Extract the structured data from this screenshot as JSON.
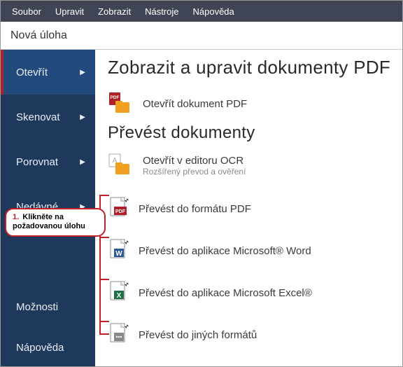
{
  "menubar": {
    "items": [
      "Soubor",
      "Upravit",
      "Zobrazit",
      "Nástroje",
      "Nápověda"
    ]
  },
  "title": "Nová úloha",
  "sidebar": {
    "nav": [
      {
        "label": "Otevřít",
        "hasArrow": true,
        "active": true
      },
      {
        "label": "Skenovat",
        "hasArrow": true
      },
      {
        "label": "Porovnat",
        "hasArrow": true
      },
      {
        "label": "Nedávné",
        "hasArrow": true
      }
    ],
    "bottom": [
      {
        "label": "Možnosti"
      },
      {
        "label": "Nápověda"
      }
    ]
  },
  "main": {
    "section1_title": "Zobrazit a upravit dokumenty PDF",
    "open_pdf_label": "Otevřít dokument PDF",
    "section2_title": "Převést dokumenty",
    "open_ocr_label": "Otevřít v editoru OCR",
    "open_ocr_sub": "Rozšířený převod a ověření",
    "convert": [
      {
        "label": "Převést do formátu PDF",
        "badge": "PDF",
        "color": "#b0202a"
      },
      {
        "label": "Převést do aplikace Microsoft® Word",
        "badge": "W",
        "color": "#2b5797"
      },
      {
        "label": "Převést do aplikace Microsoft Excel®",
        "badge": "X",
        "color": "#1e7145"
      },
      {
        "label": "Převést do jiných formátů",
        "badge": "...",
        "color": "#888888"
      }
    ]
  },
  "callout": {
    "number": "1.",
    "line1": "Klikněte na",
    "line2": "požadovanou úlohu"
  }
}
